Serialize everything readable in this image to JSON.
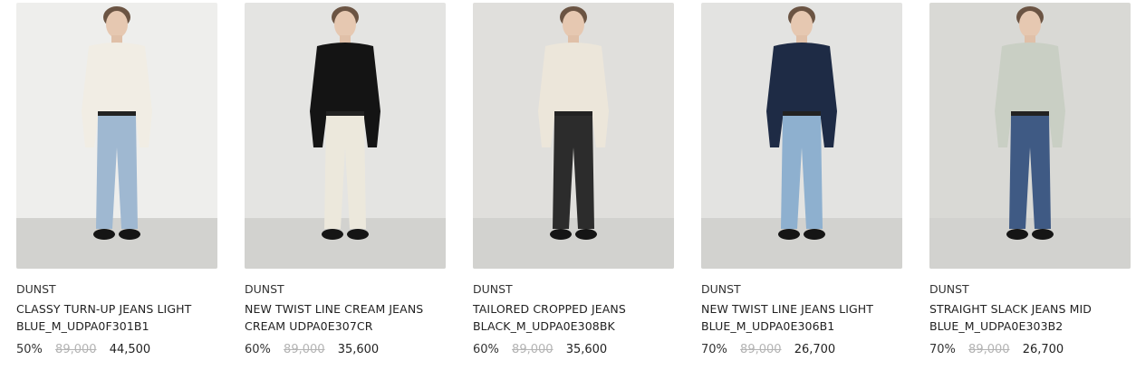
{
  "products": [
    {
      "brand": "DUNST",
      "name_line1": "CLASSY TURN-UP JEANS LIGHT",
      "name_line2": "BLUE_M_UDPA0F301B1",
      "discount": "50%",
      "original_price": "89,000",
      "sale_price": "44,500",
      "top_color": "#f1ede4",
      "pants_color": "#9fb8d1",
      "bg_color": "#eeeeec"
    },
    {
      "brand": "DUNST",
      "name_line1": "NEW TWIST LINE CREAM JEANS",
      "name_line2": "CREAM UDPA0E307CR",
      "discount": "60%",
      "original_price": "89,000",
      "sale_price": "35,600",
      "top_color": "#141414",
      "pants_color": "#ece8dc",
      "bg_color": "#e4e4e2"
    },
    {
      "brand": "DUNST",
      "name_line1": "TAILORED CROPPED JEANS",
      "name_line2": "BLACK_M_UDPA0E308BK",
      "discount": "60%",
      "original_price": "89,000",
      "sale_price": "35,600",
      "top_color": "#ece6da",
      "pants_color": "#2c2c2c",
      "bg_color": "#e0dfdc"
    },
    {
      "brand": "DUNST",
      "name_line1": "NEW TWIST LINE JEANS LIGHT",
      "name_line2": "BLUE_M_UDPA0E306B1",
      "discount": "70%",
      "original_price": "89,000",
      "sale_price": "26,700",
      "top_color": "#1e2b45",
      "pants_color": "#8eb0cf",
      "bg_color": "#e3e3e1"
    },
    {
      "brand": "DUNST",
      "name_line1": "STRAIGHT SLACK JEANS MID",
      "name_line2": "BLUE_M_UDPA0E303B2",
      "discount": "70%",
      "original_price": "89,000",
      "sale_price": "26,700",
      "top_color": "#c9cfc4",
      "pants_color": "#3f5a84",
      "bg_color": "#d9d9d5"
    }
  ]
}
